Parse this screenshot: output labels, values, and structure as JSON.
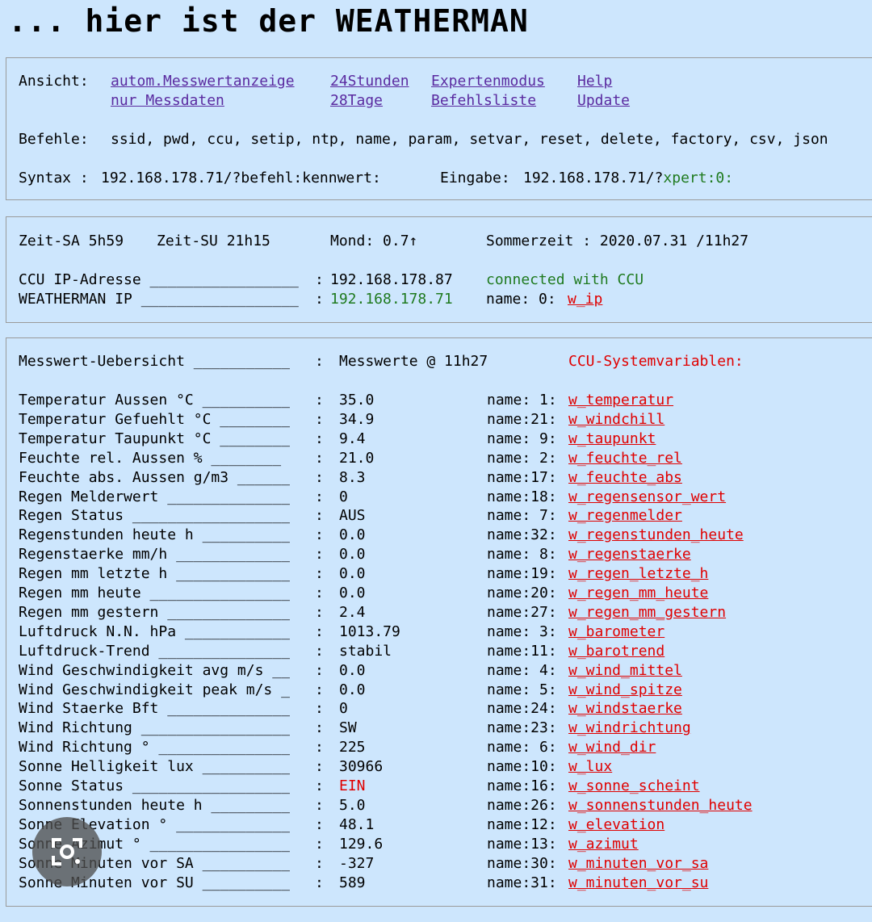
{
  "title": "... hier ist der WEATHERMAN",
  "nav": {
    "ansicht_label": "Ansicht:",
    "links": [
      {
        "label": "autom.Messwertanzeige"
      },
      {
        "label": "nur Messdaten"
      },
      {
        "label": "24Stunden"
      },
      {
        "label": "28Tage"
      },
      {
        "label": "Expertenmodus"
      },
      {
        "label": "Befehlsliste"
      },
      {
        "label": "Help"
      },
      {
        "label": "Update"
      }
    ],
    "befehle_label": "Befehle:",
    "befehle_list": "ssid, pwd, ccu, setip, ntp, name, param, setvar, reset, delete, factory, csv, json",
    "syntax_label": "Syntax :",
    "syntax_value": "192.168.178.71/?befehl:kennwert:",
    "eingabe_label": "Eingabe:",
    "eingabe_prefix": "192.168.178.71/?",
    "eingabe_value": "xpert:0:"
  },
  "status": {
    "zeit_sa": "Zeit-SA 5h59",
    "zeit_su": "Zeit-SU 21h15",
    "mond": "Mond: 0.7↑",
    "sommerzeit": "Sommerzeit : 2020.07.31 /11h27",
    "ccu_label": "CCU IP-Adresse _________________",
    "ccu_colon": ":",
    "ccu_ip": "192.168.178.87",
    "ccu_state": "connected with CCU",
    "wm_label": "WEATHERMAN IP __________________",
    "wm_colon": ":",
    "wm_ip": "192.168.178.71",
    "wm_name_prefix": "name: 0:",
    "wm_var": "w_ip"
  },
  "overview": {
    "header_label": "Messwert-Uebersicht ___________",
    "header_colon": ":",
    "header_value": "Messwerte @ 11h27",
    "header_ccu": "CCU-Systemvariablen:",
    "rows": [
      {
        "label": "Temperatur Aussen °C __________",
        "value": "35.0",
        "name": "name: 1:",
        "var": "w_temperatur"
      },
      {
        "label": "Temperatur Gefuehlt °C ________",
        "value": "34.9",
        "name": "name:21:",
        "var": "w_windchill"
      },
      {
        "label": "Temperatur Taupunkt °C ________",
        "value": "9.4",
        "name": "name: 9:",
        "var": "w_taupunkt"
      },
      {
        "label": "Feuchte rel. Aussen % ________",
        "value": "21.0",
        "name": "name: 2:",
        "var": "w_feuchte_rel"
      },
      {
        "label": "Feuchte abs. Aussen g/m3 ______",
        "value": "8.3",
        "name": "name:17:",
        "var": "w_feuchte_abs"
      },
      {
        "label": "Regen Melderwert ______________",
        "value": "0",
        "name": "name:18:",
        "var": "w_regensensor_wert"
      },
      {
        "label": "Regen Status __________________",
        "value": "AUS",
        "name": "name: 7:",
        "var": "w_regenmelder"
      },
      {
        "label": "Regenstunden heute h __________",
        "value": "0.0",
        "name": "name:32:",
        "var": "w_regenstunden_heute"
      },
      {
        "label": "Regenstaerke mm/h _____________",
        "value": "0.0",
        "name": "name: 8:",
        "var": "w_regenstaerke"
      },
      {
        "label": "Regen mm letzte h _____________",
        "value": "0.0",
        "name": "name:19:",
        "var": "w_regen_letzte_h"
      },
      {
        "label": "Regen mm heute ________________",
        "value": "0.0",
        "name": "name:20:",
        "var": "w_regen_mm_heute"
      },
      {
        "label": "Regen mm gestern ______________",
        "value": "2.4",
        "name": "name:27:",
        "var": "w_regen_mm_gestern"
      },
      {
        "label": "Luftdruck N.N. hPa ____________",
        "value": "1013.79",
        "name": "name: 3:",
        "var": "w_barometer"
      },
      {
        "label": "Luftdruck-Trend _______________",
        "value": "stabil",
        "name": "name:11:",
        "var": "w_barotrend"
      },
      {
        "label": "Wind Geschwindigkeit avg m/s __",
        "value": "0.0",
        "name": "name: 4:",
        "var": "w_wind_mittel"
      },
      {
        "label": "Wind Geschwindigkeit peak m/s _",
        "value": "0.0",
        "name": "name: 5:",
        "var": "w_wind_spitze"
      },
      {
        "label": "Wind Staerke Bft ______________",
        "value": "0",
        "name": "name:24:",
        "var": "w_windstaerke"
      },
      {
        "label": "Wind Richtung _________________",
        "value": "SW",
        "name": "name:23:",
        "var": "w_windrichtung"
      },
      {
        "label": "Wind Richtung ° _______________",
        "value": "225",
        "name": "name: 6:",
        "var": "w_wind_dir"
      },
      {
        "label": "Sonne Helligkeit lux __________",
        "value": "30966",
        "name": "name:10:",
        "var": "w_lux"
      },
      {
        "label": "Sonne Status __________________",
        "value": "EIN",
        "name": "name:16:",
        "var": "w_sonne_scheint"
      },
      {
        "label": "Sonnenstunden heute h _________",
        "value": "5.0",
        "name": "name:26:",
        "var": "w_sonnenstunden_heute"
      },
      {
        "label": "Sonne Elevation ° _____________",
        "value": "48.1",
        "name": "name:12:",
        "var": "w_elevation"
      },
      {
        "label": "Sonne Azimut ° ________________",
        "value": "129.6",
        "name": "name:13:",
        "var": "w_azimut"
      },
      {
        "label": "Sonne Minuten vor SA __________",
        "value": "-327",
        "name": "name:30:",
        "var": "w_minuten_vor_sa"
      },
      {
        "label": "Sonne Minuten vor SU __________",
        "value": "589",
        "name": "name:31:",
        "var": "w_minuten_vor_su"
      }
    ]
  },
  "colors": {
    "background": "#cde6fd",
    "link": "#5a2aa0",
    "ok": "#1f7a1f",
    "variable": "#e00000"
  },
  "overlay": {
    "icon": "lens-icon"
  }
}
